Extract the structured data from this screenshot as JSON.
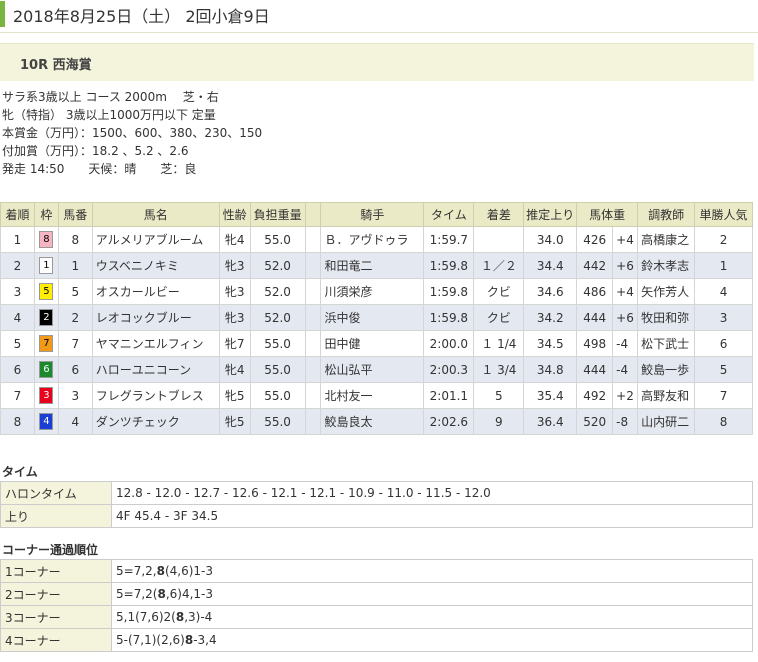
{
  "header": {
    "title": "2018年8月25日（土） 2回小倉9日"
  },
  "race": {
    "name": "10R 西海賞"
  },
  "conditions": [
    "サラ系3歳以上 コース 2000m　 芝・右",
    "牝（特指） 3歳以上1000万円以下 定量",
    "本賞金（万円）：1500、600、380、230、150",
    "付加賞（万円）：18.2 、5.2 、2.6",
    "発走 14:50　　天候：晴　　芝：良"
  ],
  "results_table": {
    "headers": [
      "着順",
      "枠",
      "馬番",
      "馬名",
      "性齢",
      "負担重量",
      "",
      "騎手",
      "タイム",
      "着差",
      "推定上り",
      "馬体重",
      "",
      "調教師",
      "単勝人気"
    ],
    "rows": [
      {
        "rank": "1",
        "waku": "8",
        "umaban": "8",
        "horse": "アルメリアブルーム",
        "sexage": "牝4",
        "weight": "55.0",
        "jockey": "Ｂ．アヴドゥラ",
        "time": "1:59.7",
        "margin": "",
        "last": "34.0",
        "bw": "426",
        "diff": "+4",
        "trainer": "高橋康之",
        "pop": "2"
      },
      {
        "rank": "2",
        "waku": "1",
        "umaban": "1",
        "horse": "ウスベニノキミ",
        "sexage": "牝3",
        "weight": "52.0",
        "jockey": "和田竜二",
        "time": "1:59.8",
        "margin": "１／２",
        "last": "34.4",
        "bw": "442",
        "diff": "+6",
        "trainer": "鈴木孝志",
        "pop": "1"
      },
      {
        "rank": "3",
        "waku": "5",
        "umaban": "5",
        "horse": "オスカールビー",
        "sexage": "牝3",
        "weight": "52.0",
        "jockey": "川須栄彦",
        "time": "1:59.8",
        "margin": "クビ",
        "last": "34.6",
        "bw": "486",
        "diff": "+4",
        "trainer": "矢作芳人",
        "pop": "4"
      },
      {
        "rank": "4",
        "waku": "2",
        "umaban": "2",
        "horse": "レオコックブルー",
        "sexage": "牝3",
        "weight": "52.0",
        "jockey": "浜中俊",
        "time": "1:59.8",
        "margin": "クビ",
        "last": "34.2",
        "bw": "444",
        "diff": "+6",
        "trainer": "牧田和弥",
        "pop": "3"
      },
      {
        "rank": "5",
        "waku": "7",
        "umaban": "7",
        "horse": "ヤマニンエルフィン",
        "sexage": "牝7",
        "weight": "55.0",
        "jockey": "田中健",
        "time": "2:00.0",
        "margin": "１ 1/4",
        "last": "34.5",
        "bw": "498",
        "diff": "-4",
        "trainer": "松下武士",
        "pop": "6"
      },
      {
        "rank": "6",
        "waku": "6",
        "umaban": "6",
        "horse": "ハローユニコーン",
        "sexage": "牝4",
        "weight": "55.0",
        "jockey": "松山弘平",
        "time": "2:00.3",
        "margin": "１ 3/4",
        "last": "34.8",
        "bw": "444",
        "diff": "-4",
        "trainer": "鮫島一歩",
        "pop": "5"
      },
      {
        "rank": "7",
        "waku": "3",
        "umaban": "3",
        "horse": "フレグラントブレス",
        "sexage": "牝5",
        "weight": "55.0",
        "jockey": "北村友一",
        "time": "2:01.1",
        "margin": "5",
        "last": "35.4",
        "bw": "492",
        "diff": "+2",
        "trainer": "高野友和",
        "pop": "7"
      },
      {
        "rank": "8",
        "waku": "4",
        "umaban": "4",
        "horse": "ダンツチェック",
        "sexage": "牝5",
        "weight": "55.0",
        "jockey": "鮫島良太",
        "time": "2:02.6",
        "margin": "9",
        "last": "36.4",
        "bw": "520",
        "diff": "-8",
        "trainer": "山内研二",
        "pop": "8"
      }
    ]
  },
  "waku_colors": {
    "1": {
      "bg": "#ffffff",
      "fg": "#000000"
    },
    "2": {
      "bg": "#000000",
      "fg": "#ffffff"
    },
    "3": {
      "bg": "#e8001c",
      "fg": "#ffffff"
    },
    "4": {
      "bg": "#1a3fd6",
      "fg": "#ffffff"
    },
    "5": {
      "bg": "#ffee00",
      "fg": "#000000"
    },
    "6": {
      "bg": "#1a8a2c",
      "fg": "#ffffff"
    },
    "7": {
      "bg": "#f29a17",
      "fg": "#000000"
    },
    "8": {
      "bg": "#f7b4c3",
      "fg": "#000000"
    }
  },
  "time_section": {
    "title": "タイム",
    "rows": [
      {
        "label": "ハロンタイム",
        "value": "12.8 - 12.0 - 12.7 - 12.6 - 12.1 - 12.1 - 10.9 - 11.0 - 11.5 - 12.0"
      },
      {
        "label": "上り",
        "value": "4F 45.4 - 3F 34.5"
      }
    ]
  },
  "corner_section": {
    "title": "コーナー通過順位",
    "rows": [
      {
        "label": "1コーナー",
        "parts": [
          {
            "t": "5=7,2,"
          },
          {
            "t": "8",
            "b": true
          },
          {
            "t": "(4,6)1-3"
          }
        ]
      },
      {
        "label": "2コーナー",
        "parts": [
          {
            "t": "5=7,2("
          },
          {
            "t": "8",
            "b": true
          },
          {
            "t": ",6)4,1-3"
          }
        ]
      },
      {
        "label": "3コーナー",
        "parts": [
          {
            "t": "5,1(7,6)2("
          },
          {
            "t": "8",
            "b": true
          },
          {
            "t": ",3)-4"
          }
        ]
      },
      {
        "label": "4コーナー",
        "parts": [
          {
            "t": "5-(7,1)(2,6)"
          },
          {
            "t": "8",
            "b": true
          },
          {
            "t": "-3,4"
          }
        ]
      }
    ]
  }
}
